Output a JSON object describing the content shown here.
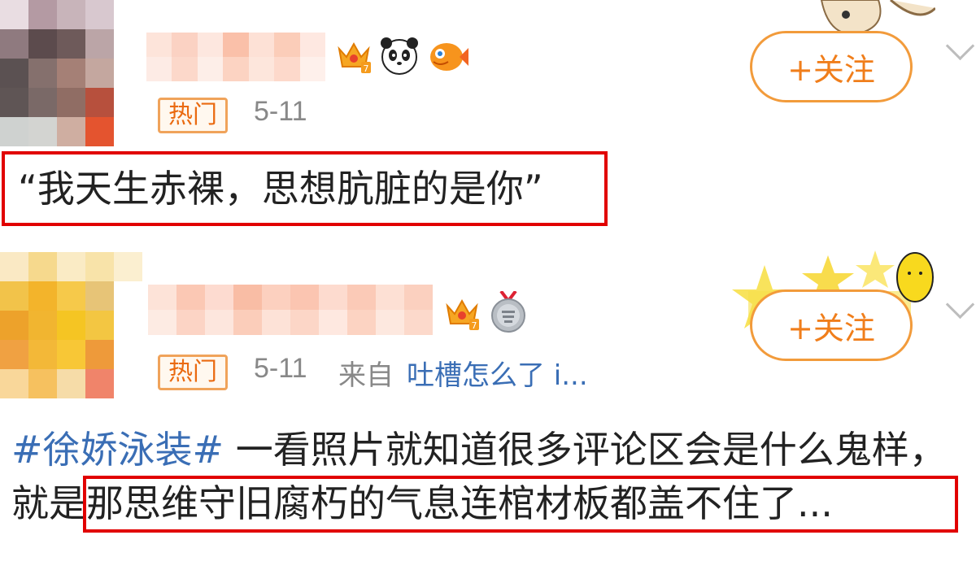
{
  "comments": [
    {
      "tag": "热门",
      "date": "5-11",
      "follow_label": "+关注",
      "badges": [
        "crown-7-icon",
        "panda-icon",
        "fish-icon"
      ],
      "quote": "“我天生赤裸，思想肮脏的是你”"
    },
    {
      "tag": "热门",
      "date": "5-11",
      "from_label": "来自",
      "from_link": "吐槽怎么了 i...",
      "follow_label": "+关注",
      "badges": [
        "crown-7-icon",
        "answer-medal-icon"
      ],
      "hashtag": "#徐娇泳装#",
      "text_before": " 一看照片就知道很多评论区会是什么鬼样，",
      "highlighted": "就是那思维守旧腐朽的气息连棺材板都盖不住",
      "text_after": "了..."
    }
  ],
  "colors": {
    "accent_orange": "#f07e1b",
    "link_blue": "#3a6eb5",
    "highlight_red": "#e10000"
  }
}
